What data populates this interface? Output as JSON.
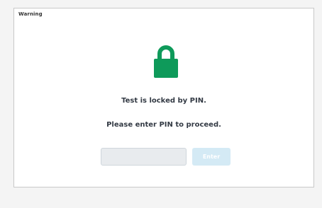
{
  "dialog": {
    "title": "Warning",
    "icon": "lock-icon",
    "message_locked": "Test is locked by PIN.",
    "message_enter": "Please enter PIN to proceed.",
    "pin_input": {
      "value": "",
      "placeholder": ""
    },
    "enter_button_label": "Enter"
  },
  "colors": {
    "lock_green": "#0e9a5a",
    "button_disabled_bg": "#d4eaf5",
    "input_bg": "#e8ebee",
    "text": "#333a44"
  }
}
